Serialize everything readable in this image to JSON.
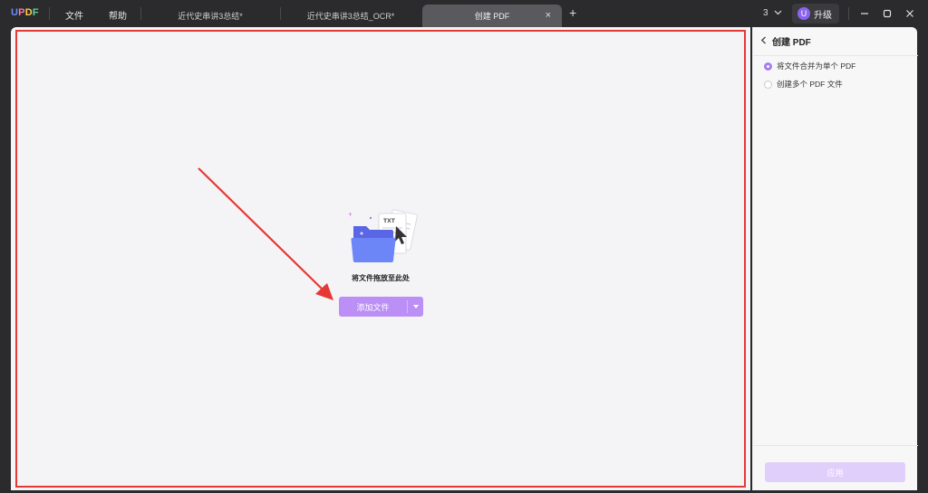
{
  "app": {
    "logo": {
      "u": "U",
      "p": "P",
      "d": "D",
      "f": "F"
    },
    "menu": {
      "file": "文件",
      "help": "帮助"
    }
  },
  "tabs": [
    {
      "label": "近代史串讲3总结*",
      "active": false
    },
    {
      "label": "近代史串讲3总结_OCR*",
      "active": false
    },
    {
      "label": "创建 PDF",
      "active": true,
      "close": "×"
    }
  ],
  "titlebar": {
    "new_tab": "+",
    "count": "3",
    "upgrade": {
      "avatar": "U",
      "label": "升级"
    }
  },
  "main": {
    "drop_text": "将文件拖放至此处",
    "add_button": "添加文件",
    "illustration_label": "TXT"
  },
  "panel": {
    "title": "创建 PDF",
    "options": [
      {
        "label": "将文件合并为单个 PDF",
        "selected": true
      },
      {
        "label": "创建多个 PDF 文件",
        "selected": false
      }
    ],
    "apply_button": "应用"
  },
  "colors": {
    "accent": "#bb8ff5",
    "annotation_red": "#e53935",
    "titlebar_bg": "#2b2b2d"
  }
}
